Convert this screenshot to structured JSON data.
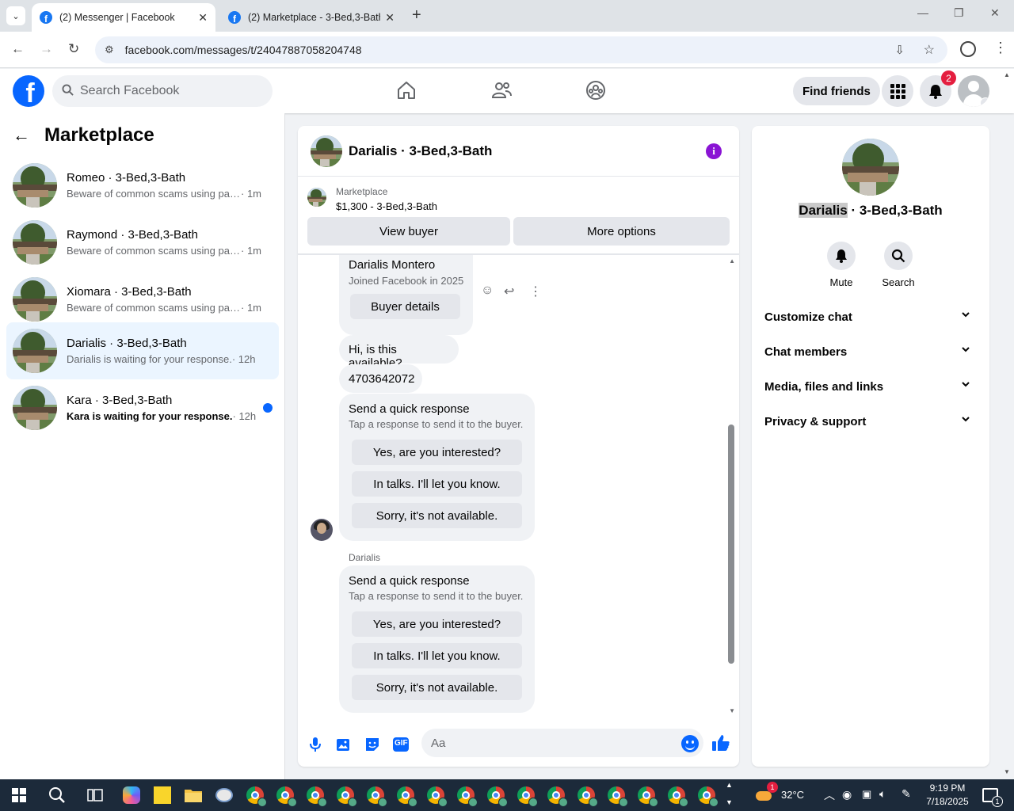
{
  "browser": {
    "tabs": [
      {
        "title": "(2) Messenger | Facebook",
        "active": true
      },
      {
        "title": "(2) Marketplace - 3-Bed,3-Bath",
        "active": false
      }
    ],
    "url": "facebook.com/messages/t/24047887058204748"
  },
  "fb_header": {
    "search_placeholder": "Search Facebook",
    "find_friends": "Find friends",
    "notification_count": "2"
  },
  "sidebar": {
    "title": "Marketplace",
    "conversations": [
      {
        "name": "Romeo · 3-Bed,3-Bath",
        "snippet": "Beware of common scams using pay...",
        "time": "· 1m",
        "unread": false,
        "selected": false
      },
      {
        "name": "Raymond · 3-Bed,3-Bath",
        "snippet": "Beware of common scams using pay...",
        "time": "· 1m",
        "unread": false,
        "selected": false
      },
      {
        "name": "Xiomara · 3-Bed,3-Bath",
        "snippet": "Beware of common scams using pay...",
        "time": "· 1m",
        "unread": false,
        "selected": false
      },
      {
        "name": "Darialis · 3-Bed,3-Bath",
        "snippet": "Darialis is waiting for your response.",
        "time": "· 12h",
        "unread": false,
        "selected": true
      },
      {
        "name": "Kara · 3-Bed,3-Bath",
        "snippet": "Kara is waiting for your response.",
        "time": "· 12h",
        "unread": true,
        "selected": false
      }
    ]
  },
  "chat": {
    "title": "Darialis · 3-Bed,3-Bath",
    "marketplace_label": "Marketplace",
    "listing": "$1,300 - 3-Bed,3-Bath",
    "view_buyer": "View buyer",
    "more_options": "More options",
    "buyer_card": {
      "name": "Darialis Montero",
      "joined": "Joined Facebook in 2025",
      "button": "Buyer details"
    },
    "messages": [
      "Hi, is this available?",
      "4703642072"
    ],
    "quick_response": {
      "title": "Send a quick response",
      "subtitle": "Tap a response to send it to the buyer.",
      "options": [
        "Yes, are you interested?",
        "In talks. I'll let you know.",
        "Sorry, it's not available."
      ]
    },
    "sender_label": "Darialis",
    "composer_placeholder": "Aa"
  },
  "info_panel": {
    "name_highlight": "Darialis",
    "name_rest": " · 3-Bed,3-Bath",
    "actions": [
      {
        "label": "Mute",
        "icon": "bell-icon"
      },
      {
        "label": "Search",
        "icon": "search-icon"
      }
    ],
    "sections": [
      "Customize chat",
      "Chat members",
      "Media, files and links",
      "Privacy & support"
    ]
  },
  "taskbar": {
    "weather_temp": "32°C",
    "weather_badge": "1",
    "time": "9:19 PM",
    "date": "7/18/2025",
    "notification_count": "1"
  },
  "colors": {
    "fb_blue": "#0866ff",
    "selected_convo": "#ebf5ff",
    "info_purple": "#8a14d4",
    "badge_red": "#e41e3f"
  }
}
